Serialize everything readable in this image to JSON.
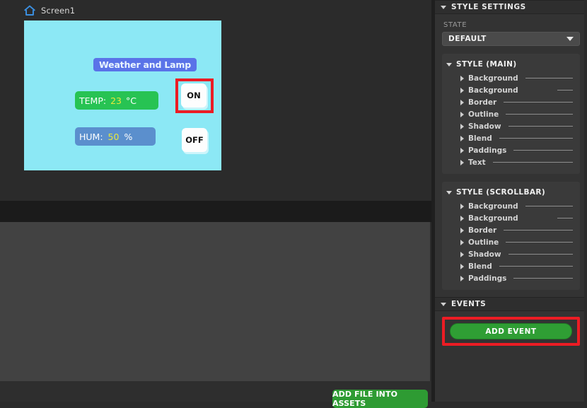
{
  "editor": {
    "screen_tab": {
      "icon": "home-icon",
      "label": "Screen1"
    },
    "canvas": {
      "background_color": "#8ce8f5",
      "widgets": {
        "title_label": {
          "text": "Weather and Lamp",
          "bg": "#5a73e8",
          "fg": "#e9f5ff"
        },
        "temp_label": {
          "key": "TEMP:",
          "value": "23",
          "unit": "°C",
          "bg": "#27c353",
          "value_color": "#e8e83a"
        },
        "hum_label": {
          "key": "HUM:",
          "value": "50",
          "unit": "%",
          "bg": "#5b8fcd",
          "value_color": "#e8e83a"
        },
        "on_button": {
          "label": "ON",
          "selected": true,
          "selection_color": "#ec1c24"
        },
        "off_button": {
          "label": "OFF",
          "selected": false
        }
      }
    },
    "assets_button": {
      "label": "ADD FILE INTO ASSETS",
      "color": "#2e9b33"
    }
  },
  "sidebar": {
    "style_settings": {
      "title": "STYLE SETTINGS",
      "state": {
        "label": "STATE",
        "value": "DEFAULT",
        "caret": "chevron-down-icon"
      },
      "groups": [
        {
          "title": "STYLE (MAIN)",
          "properties": [
            {
              "name": "Background",
              "rule": "long"
            },
            {
              "name": "Background",
              "rule": "short"
            },
            {
              "name": "Border",
              "rule": "long"
            },
            {
              "name": "Outline",
              "rule": "long"
            },
            {
              "name": "Shadow",
              "rule": "long"
            },
            {
              "name": "Blend",
              "rule": "long"
            },
            {
              "name": "Paddings",
              "rule": "long"
            },
            {
              "name": "Text",
              "rule": "long"
            }
          ]
        },
        {
          "title": "STYLE (SCROLLBAR)",
          "properties": [
            {
              "name": "Background",
              "rule": "long"
            },
            {
              "name": "Background",
              "rule": "short"
            },
            {
              "name": "Border",
              "rule": "long"
            },
            {
              "name": "Outline",
              "rule": "long"
            },
            {
              "name": "Shadow",
              "rule": "long"
            },
            {
              "name": "Blend",
              "rule": "long"
            },
            {
              "name": "Paddings",
              "rule": "long"
            }
          ]
        }
      ]
    },
    "events": {
      "title": "EVENTS",
      "add_event_label": "ADD EVENT",
      "add_event_color": "#2f9e34",
      "highlight_color": "#ec1c24"
    }
  }
}
